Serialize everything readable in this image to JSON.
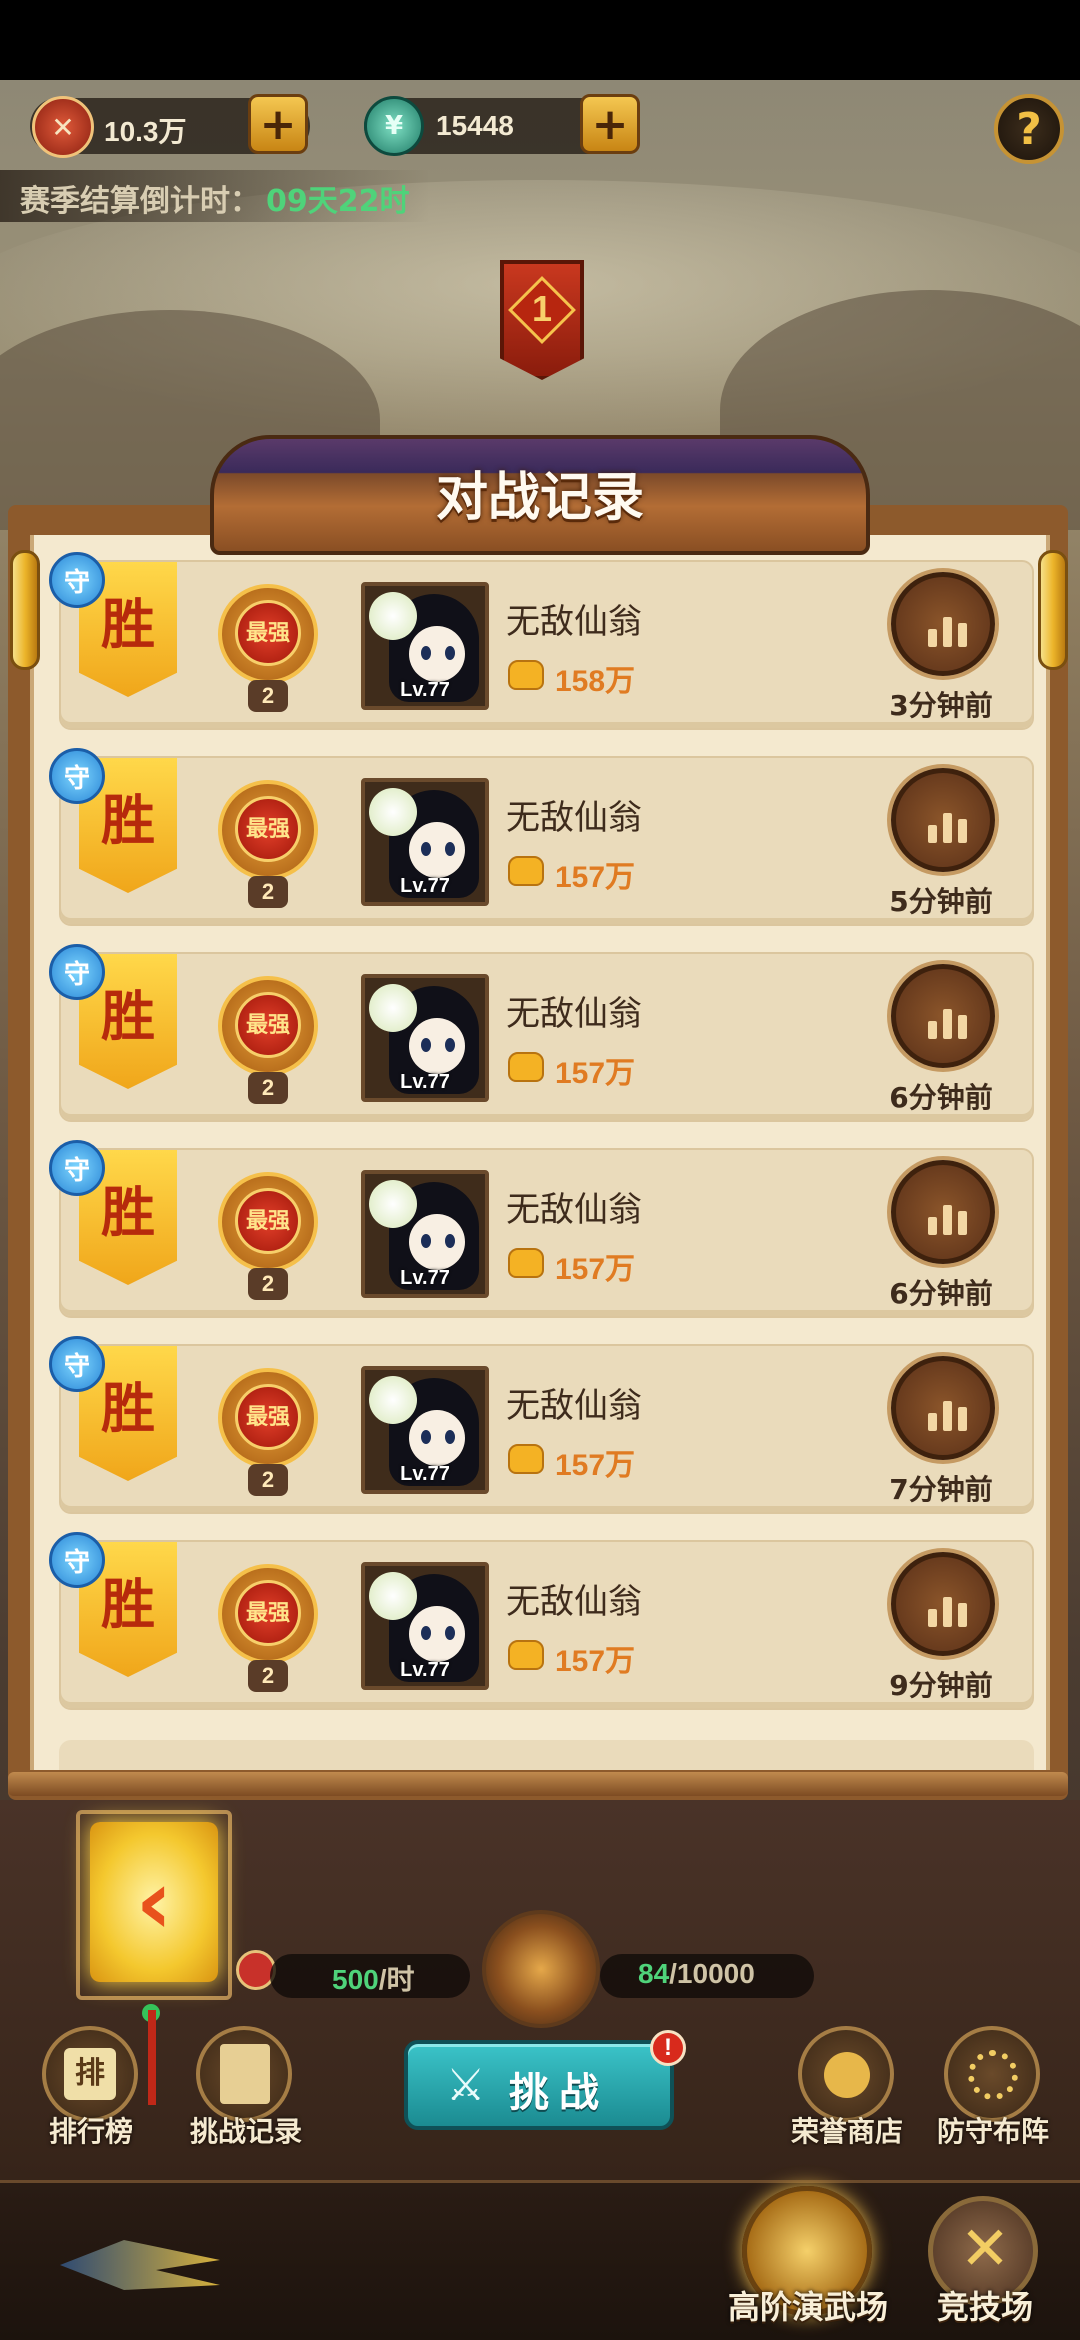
{
  "header": {
    "currency1": {
      "value": "10.3万",
      "icon": "swords-badge-icon",
      "add_icon": "plus-icon"
    },
    "currency2": {
      "value": "15448",
      "icon": "jade-coin-icon",
      "add_icon": "plus-icon"
    },
    "help_icon": "question-icon",
    "help_glyph": "?",
    "season_countdown_label": "赛季结算倒计时：",
    "season_countdown_value": "09天22时"
  },
  "rank_banner": {
    "number": "1"
  },
  "modal": {
    "title": "对战记录",
    "records": [
      {
        "role_tag": "守",
        "result": "胜",
        "rank_title": "最强",
        "rank_level": "2",
        "level": "Lv.77",
        "name": "无敌仙翁",
        "power": "158万",
        "time_ago": "3分钟前"
      },
      {
        "role_tag": "守",
        "result": "胜",
        "rank_title": "最强",
        "rank_level": "2",
        "level": "Lv.77",
        "name": "无敌仙翁",
        "power": "157万",
        "time_ago": "5分钟前"
      },
      {
        "role_tag": "守",
        "result": "胜",
        "rank_title": "最强",
        "rank_level": "2",
        "level": "Lv.77",
        "name": "无敌仙翁",
        "power": "157万",
        "time_ago": "6分钟前"
      },
      {
        "role_tag": "守",
        "result": "胜",
        "rank_title": "最强",
        "rank_level": "2",
        "level": "Lv.77",
        "name": "无敌仙翁",
        "power": "157万",
        "time_ago": "6分钟前"
      },
      {
        "role_tag": "守",
        "result": "胜",
        "rank_title": "最强",
        "rank_level": "2",
        "level": "Lv.77",
        "name": "无敌仙翁",
        "power": "157万",
        "time_ago": "7分钟前"
      },
      {
        "role_tag": "守",
        "result": "胜",
        "rank_title": "最强",
        "rank_level": "2",
        "level": "Lv.77",
        "name": "无敌仙翁",
        "power": "157万",
        "time_ago": "9分钟前"
      }
    ]
  },
  "production": {
    "rate_value": "500",
    "rate_unit": "/时",
    "stored": "84",
    "capacity": "/10000"
  },
  "actions": {
    "back_glyph": "‹",
    "leaderboard_label": "排行榜",
    "leaderboard_glyph": "排",
    "challenge_log_label": "挑战记录",
    "challenge_label": "挑战",
    "challenge_alert": "!",
    "honor_shop_label": "荣誉商店",
    "defense_label": "防守布阵"
  },
  "tabs": {
    "advanced_arena_label": "高阶演武场",
    "arena_label": "竞技场"
  },
  "colors": {
    "win_flag": "#f4b224",
    "power_text": "#e07b22",
    "countdown_green": "#4fd37a",
    "production_green": "#4fd37a",
    "challenge_teal": "#2aa7ad"
  }
}
